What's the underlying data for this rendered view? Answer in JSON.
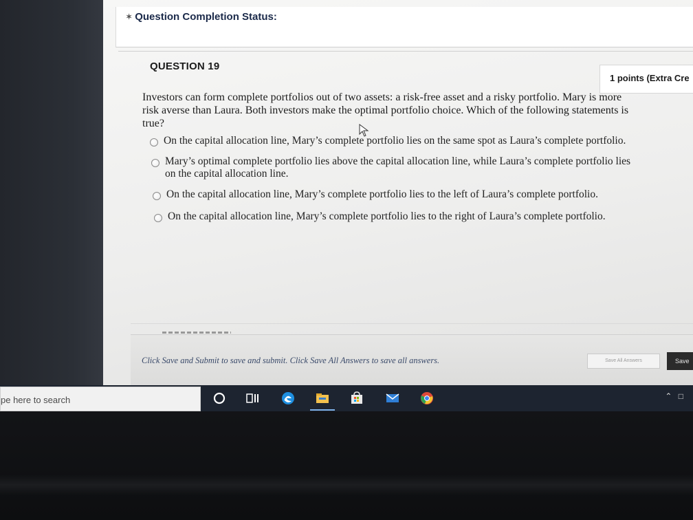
{
  "status": {
    "title": "Question Completion Status:"
  },
  "question": {
    "title": "QUESTION 19",
    "points": "1 points (Extra Cre",
    "text": "Investors can form complete portfolios out of two assets: a risk-free asset and a risky portfolio. Mary is more risk averse than Laura. Both investors make the optimal portfolio choice. Which of the following statements is true?",
    "options": [
      {
        "label": "On the capital allocation line, Mary’s complete portfolio lies on the same spot as Laura’s complete portfolio."
      },
      {
        "label": "Mary’s optimal complete portfolio lies above the capital allocation line, while Laura’s complete portfolio lies on the capital allocation line."
      },
      {
        "label": "On the capital allocation line, Mary’s complete portfolio lies to the left of Laura’s complete portfolio."
      },
      {
        "label": "On the capital allocation line, Mary’s complete portfolio lies to the right of Laura’s complete portfolio."
      }
    ]
  },
  "footer": {
    "instructions": "Click Save and Submit to save and submit. Click Save All Answers to save all answers.",
    "save_all_label": "Save All Answers",
    "save_submit_label": "Save"
  },
  "taskbar": {
    "search_placeholder": "pe here to search",
    "icons": [
      "cortana-circle-icon",
      "task-view-icon",
      "edge-icon",
      "file-explorer-icon",
      "store-icon",
      "mail-icon",
      "chrome-icon"
    ]
  },
  "colors": {
    "heading": "#1b2a4a",
    "footer_text": "#3a4a6a",
    "taskbar": "#1d2430"
  }
}
